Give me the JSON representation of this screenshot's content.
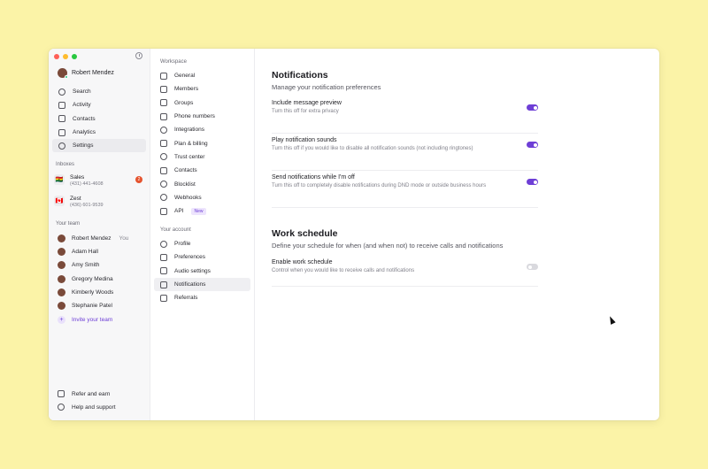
{
  "user": {
    "name": "Robert Mendez"
  },
  "nav": [
    {
      "label": "Search",
      "icon": "search-icon"
    },
    {
      "label": "Activity",
      "icon": "bell-icon"
    },
    {
      "label": "Contacts",
      "icon": "contacts-icon"
    },
    {
      "label": "Analytics",
      "icon": "chart-icon"
    },
    {
      "label": "Settings",
      "icon": "gear-icon",
      "active": true
    }
  ],
  "inboxes_label": "Inboxes",
  "inboxes": [
    {
      "name": "Sales",
      "number": "(431) 441-4608",
      "badge": "2"
    },
    {
      "name": "Zest",
      "number": "(436) 601-9539"
    }
  ],
  "team_label": "Your team",
  "team": [
    {
      "name": "Robert Mendez",
      "suffix": "You"
    },
    {
      "name": "Adam Hall"
    },
    {
      "name": "Amy Smith"
    },
    {
      "name": "Gregory Medina"
    },
    {
      "name": "Kimberly Woods"
    },
    {
      "name": "Stephanie Patel"
    }
  ],
  "invite_label": "Invite your team",
  "footer": [
    {
      "label": "Refer and earn"
    },
    {
      "label": "Help and support"
    }
  ],
  "workspace_label": "Workspace",
  "workspace": [
    {
      "label": "General"
    },
    {
      "label": "Members"
    },
    {
      "label": "Groups"
    },
    {
      "label": "Phone numbers"
    },
    {
      "label": "Integrations"
    },
    {
      "label": "Plan & billing"
    },
    {
      "label": "Trust center"
    },
    {
      "label": "Contacts"
    },
    {
      "label": "Blocklist"
    },
    {
      "label": "Webhooks"
    },
    {
      "label": "API",
      "badge": "New"
    }
  ],
  "account_label": "Your account",
  "account": [
    {
      "label": "Profile"
    },
    {
      "label": "Preferences"
    },
    {
      "label": "Audio settings"
    },
    {
      "label": "Notifications",
      "active": true
    },
    {
      "label": "Referrals"
    }
  ],
  "notifications": {
    "title": "Notifications",
    "subtitle": "Manage your notification preferences",
    "rows": [
      {
        "title": "Include message preview",
        "desc": "Turn this off for extra privacy",
        "on": true
      },
      {
        "title": "Play notification sounds",
        "desc": "Turn this off if you would like to disable all notification sounds (not including ringtones)",
        "on": true
      },
      {
        "title": "Send notifications while I'm off",
        "desc": "Turn this off to completely disable notifications during DND mode or outside business hours",
        "on": true
      }
    ]
  },
  "schedule": {
    "title": "Work schedule",
    "subtitle": "Define your schedule for when (and when not) to receive calls and notifications",
    "row": {
      "title": "Enable work schedule",
      "desc": "Control when you would like to receive calls and notifications",
      "on": false
    }
  },
  "colors": {
    "accent": "#6E3FD6",
    "background": "#FBF3A7",
    "badge": "#E5532E"
  }
}
